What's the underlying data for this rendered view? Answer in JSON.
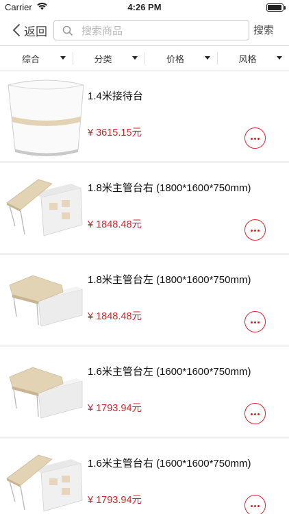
{
  "status_bar": {
    "carrier": "Carrier",
    "time": "4:26 PM"
  },
  "nav": {
    "back_label": "返回",
    "search_placeholder": "搜索商品",
    "search_button": "搜索"
  },
  "filters": [
    {
      "label": "综合"
    },
    {
      "label": "分类"
    },
    {
      "label": "价格"
    },
    {
      "label": "风格"
    }
  ],
  "products": [
    {
      "name": "1.4米接待台",
      "price": "¥ 3615.15元",
      "image": "reception-desk"
    },
    {
      "name": "1.8米主管台右 (1800*1600*750mm)",
      "price": "¥ 1848.48元",
      "image": "desk-right"
    },
    {
      "name": "1.8米主管台左 (1800*1600*750mm)",
      "price": "¥ 1848.48元",
      "image": "desk-left"
    },
    {
      "name": "1.6米主管台左 (1600*1600*750mm)",
      "price": "¥ 1793.94元",
      "image": "desk-left"
    },
    {
      "name": "1.6米主管台右 (1600*1600*750mm)",
      "price": "¥ 1793.94元",
      "image": "desk-right"
    }
  ],
  "colors": {
    "accent": "#d2262b",
    "price": "#c9272b",
    "wood": "#e3d3b5"
  }
}
